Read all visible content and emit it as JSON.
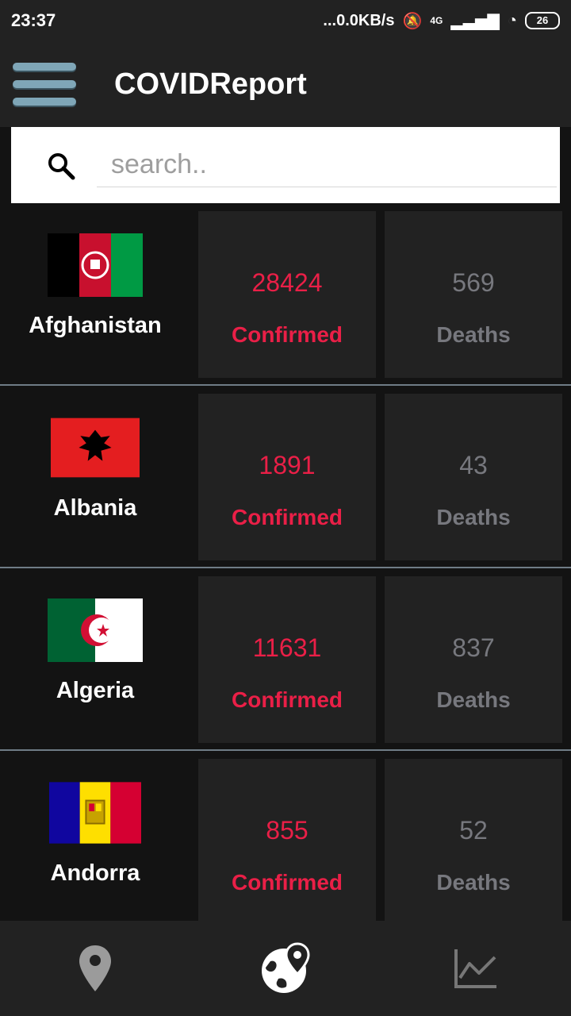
{
  "status_bar": {
    "time": "23:37",
    "network": "...0.0KB/s",
    "signal": "4G",
    "battery": "26"
  },
  "app_bar": {
    "title": "COVIDReport",
    "menu_icon": "hamburger-menu-icon"
  },
  "search": {
    "placeholder": "search..",
    "icon": "search-icon"
  },
  "countries": [
    {
      "name": "Afghanistan",
      "confirmed": "28424",
      "deaths": "569",
      "flag": "afghanistan-flag"
    },
    {
      "name": "Albania",
      "confirmed": "1891",
      "deaths": "43",
      "flag": "albania-flag"
    },
    {
      "name": "Algeria",
      "confirmed": "11631",
      "deaths": "837",
      "flag": "algeria-flag"
    },
    {
      "name": "Andorra",
      "confirmed": "855",
      "deaths": "52",
      "flag": "andorra-flag"
    }
  ],
  "labels": {
    "confirmed": "Confirmed",
    "deaths": "Deaths"
  },
  "bottom_nav": [
    {
      "icon": "location-pin-icon",
      "active": false
    },
    {
      "icon": "globe-location-icon",
      "active": true
    },
    {
      "icon": "line-chart-icon",
      "active": false
    }
  ],
  "colors": {
    "confirmed": "#ea1f47",
    "deaths": "#77787e",
    "background": "#131313",
    "card": "#222222"
  }
}
